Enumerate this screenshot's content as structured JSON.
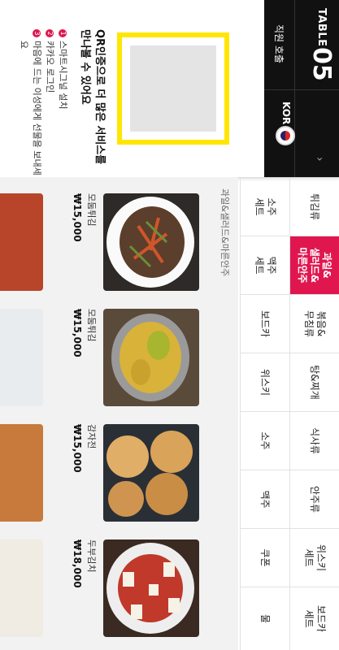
{
  "header": {
    "table_label": "TABLE",
    "table_number": "05",
    "staff_call": "직원 호출",
    "language": "KOR",
    "arrow": "›",
    "qr_title": "QR인증으로 더 많은 서비스를 만나볼 수 있어요",
    "steps": [
      {
        "num": "1",
        "text": "스마트시그널 설치"
      },
      {
        "num": "2",
        "text": "카카오 로그인"
      },
      {
        "num": "3",
        "text": "마음에 드는 이성에게 선물을 보내세요"
      }
    ],
    "colors": {
      "accent": "#e0174f",
      "qr_frame": "#ffe600",
      "bar": "#111111"
    }
  },
  "categories": [
    {
      "label": "튀김류"
    },
    {
      "label": "소주\n세트"
    },
    {
      "label": "과일&\n샐러드&\n마른안주",
      "active": true
    },
    {
      "label": "맥주\n세트"
    },
    {
      "label": "볶음&\n무침류"
    },
    {
      "label": "보드카"
    },
    {
      "label": "탕&찌개"
    },
    {
      "label": "위스키"
    },
    {
      "label": "식사류"
    },
    {
      "label": "소주"
    },
    {
      "label": "안주류"
    },
    {
      "label": "맥주"
    },
    {
      "label": "위스키\n세트"
    },
    {
      "label": "쿠폰"
    },
    {
      "label": "보드카\n세트"
    },
    {
      "label": "물"
    }
  ],
  "section_title": "과일&샐러드&마른안주",
  "menu_items": [
    {
      "name": "두부김치",
      "price": "₩18,000"
    },
    {
      "name": "감자전",
      "price": "₩15,000"
    },
    {
      "name": "모둠튀김",
      "price": "₩15,000"
    },
    {
      "name": "모둠튀김",
      "price": "₩15,000"
    }
  ]
}
